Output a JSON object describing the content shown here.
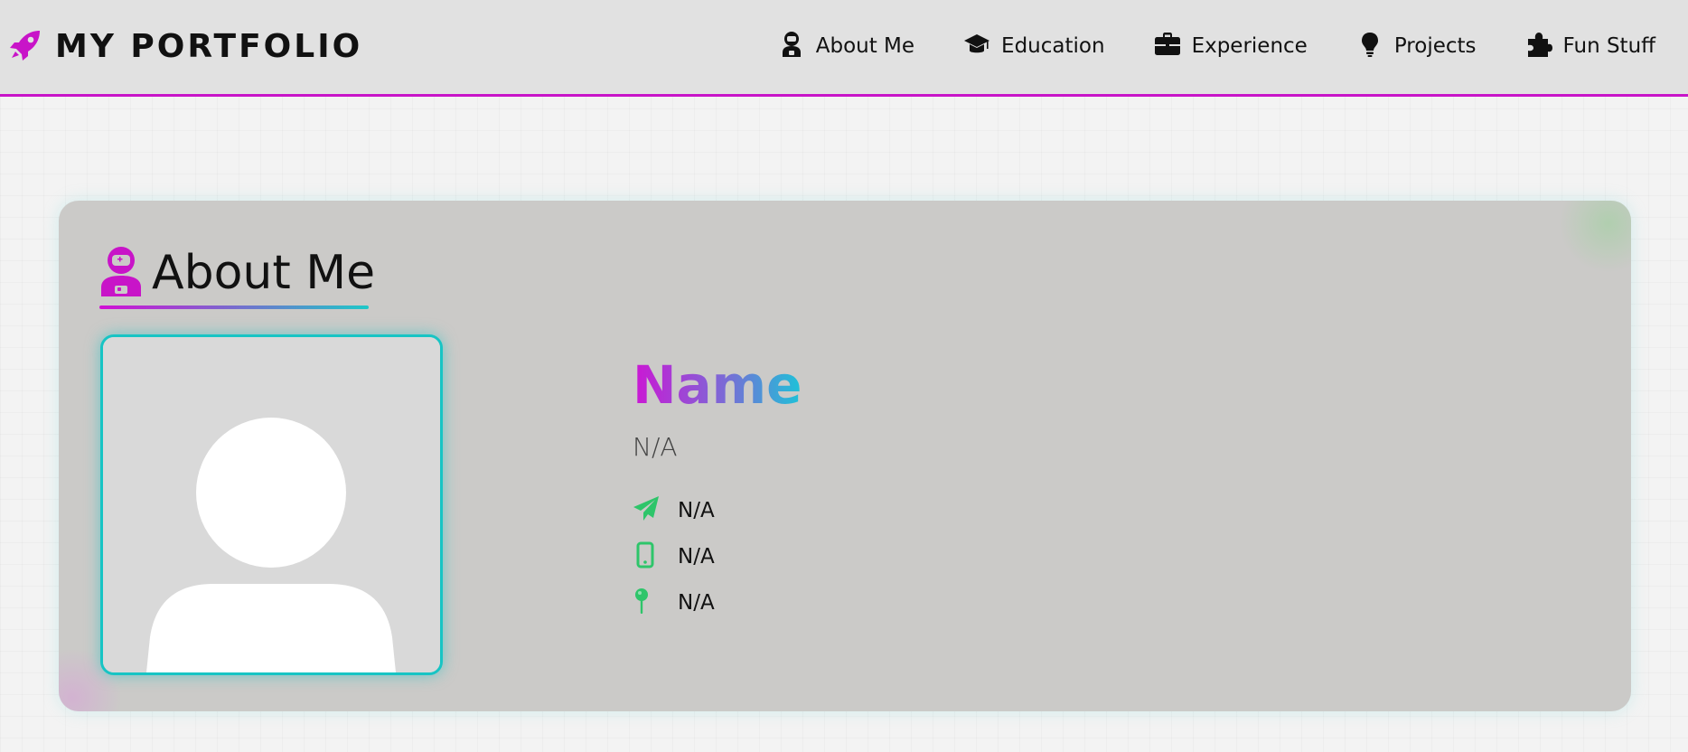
{
  "navbar": {
    "brand": "MY PORTFOLIO",
    "brand_icon": "rocket-icon",
    "items": [
      {
        "label": "About Me",
        "icon": "astronaut-icon"
      },
      {
        "label": "Education",
        "icon": "graduation-cap-icon"
      },
      {
        "label": "Experience",
        "icon": "briefcase-icon"
      },
      {
        "label": "Projects",
        "icon": "lightbulb-icon"
      },
      {
        "label": "Fun Stuff",
        "icon": "puzzle-piece-icon"
      }
    ]
  },
  "about": {
    "title": "About Me",
    "title_icon": "astronaut-icon",
    "photo": "profile-placeholder",
    "name": "Name",
    "subtitle": "N/A",
    "contacts": [
      {
        "icon": "paper-plane-icon",
        "value": "N/A"
      },
      {
        "icon": "mobile-phone-icon",
        "value": "N/A"
      },
      {
        "icon": "map-pin-icon",
        "value": "N/A"
      }
    ]
  },
  "colors": {
    "accent": "#c814c8",
    "teal": "#17c4c4",
    "contact_icon": "#2ec56a",
    "navbar_bg": "#e1e1e1",
    "card_bg": "#cbcac8"
  }
}
